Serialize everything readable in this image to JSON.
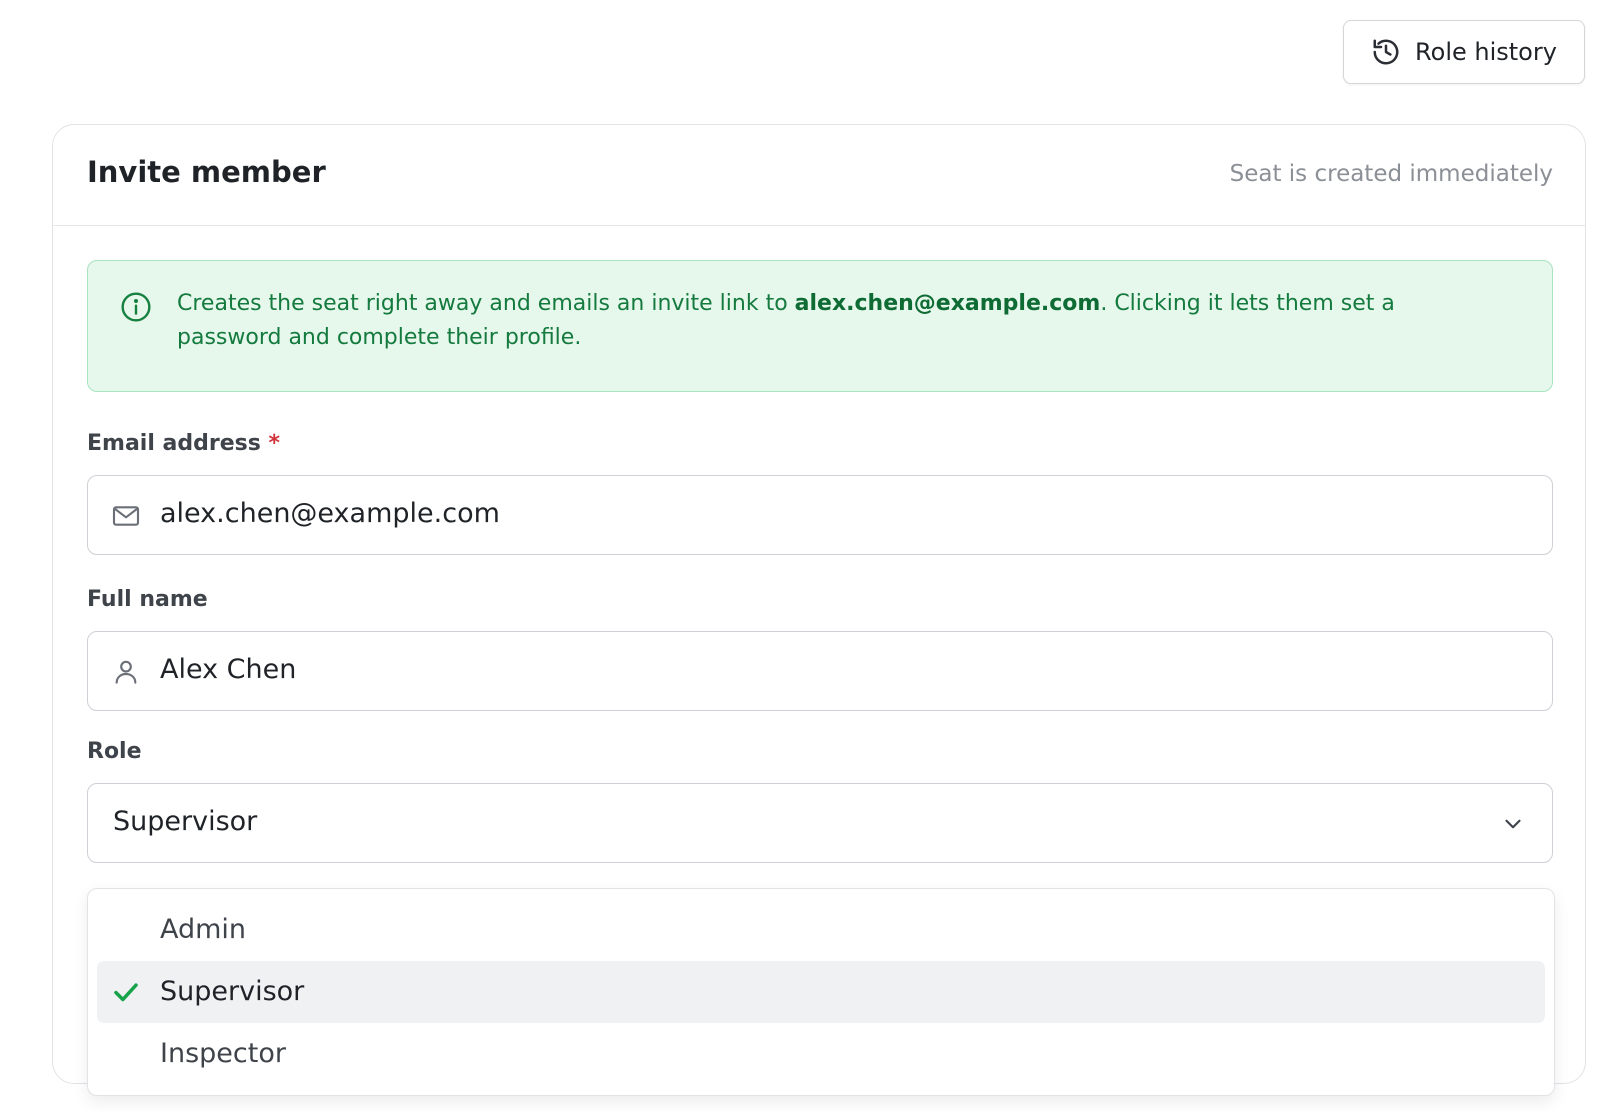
{
  "header": {
    "role_history_label": "Role history"
  },
  "card": {
    "title": "Invite member",
    "subtitle": "Seat is created immediately"
  },
  "notice": {
    "text_before": "Creates the seat right away and emails an invite link to ",
    "email": "alex.chen@example.com",
    "text_after": ". Clicking it lets them set a password and complete their profile.",
    "icon": "info-icon"
  },
  "fields": {
    "email": {
      "label": "Email address",
      "required_mark": "*",
      "value": "alex.chen@example.com",
      "icon": "mail-icon"
    },
    "full_name": {
      "label": "Full name",
      "value": "Alex Chen",
      "icon": "user-icon"
    },
    "role": {
      "label": "Role",
      "value": "Supervisor",
      "icon": "chevron-down-icon"
    }
  },
  "role_options": [
    {
      "label": "Admin",
      "selected": false
    },
    {
      "label": "Supervisor",
      "selected": true
    },
    {
      "label": "Inspector",
      "selected": false
    }
  ],
  "colors": {
    "accent_green": "#16a34a",
    "notice_bg": "#e6f7ec",
    "required_red": "#d0343a"
  }
}
